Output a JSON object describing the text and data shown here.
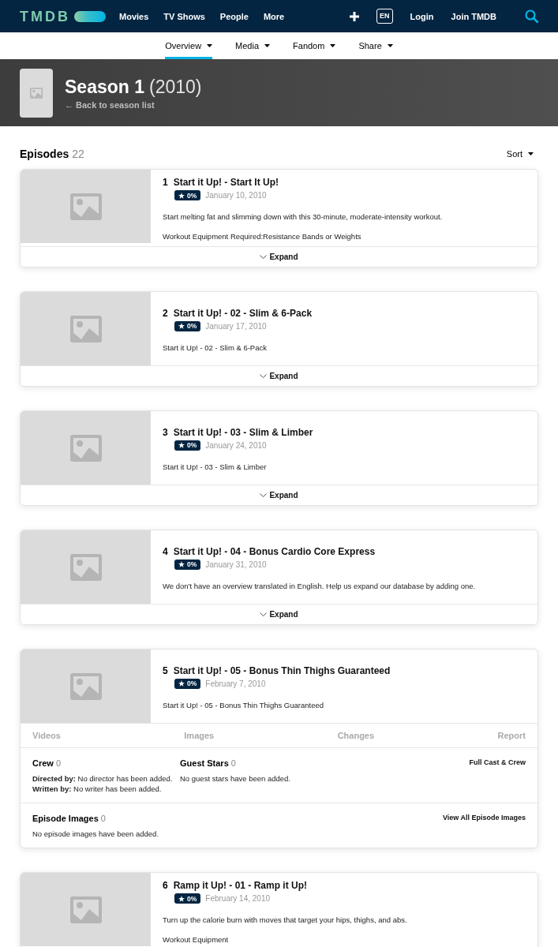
{
  "top_nav": {
    "logo": "TMDB",
    "links": [
      "Movies",
      "TV Shows",
      "People",
      "More"
    ],
    "language": "EN",
    "account_links": [
      "Login",
      "Join TMDB"
    ]
  },
  "sub_nav": {
    "tabs": [
      {
        "label": "Overview",
        "selected": true
      },
      {
        "label": "Media",
        "selected": false
      },
      {
        "label": "Fandom",
        "selected": false
      },
      {
        "label": "Share",
        "selected": false
      }
    ]
  },
  "season_header": {
    "title": "Season 1",
    "year": "(2010)",
    "back_link": "← Back to season list"
  },
  "episodes_section": {
    "heading": "Episodes",
    "count": "22",
    "sort_label": "Sort"
  },
  "episodes": [
    {
      "number": "1",
      "title": "Start it Up! - Start It Up!",
      "rating": "0%",
      "air_date": "January 10, 2010",
      "overview": [
        "Start melting fat and slimming down with this 30-minute, moderate-intensity workout.",
        "Workout Equipment Required:Resistance Bands or Weights"
      ],
      "expanded": false,
      "expand_label": "Expand"
    },
    {
      "number": "2",
      "title": "Start it Up! - 02 - Slim & 6-Pack",
      "rating": "0%",
      "air_date": "January 17, 2010",
      "overview": [
        "Start it Up! - 02 - Slim & 6-Pack"
      ],
      "expanded": false,
      "expand_label": "Expand"
    },
    {
      "number": "3",
      "title": "Start it Up! - 03 - Slim & Limber",
      "rating": "0%",
      "air_date": "January 24, 2010",
      "overview": [
        "Start it Up! - 03 - Slim & Limber"
      ],
      "expanded": false,
      "expand_label": "Expand"
    },
    {
      "number": "4",
      "title": "Start it Up! - 04 - Bonus Cardio Core Express",
      "rating": "0%",
      "air_date": "January 31, 2010",
      "overview": [
        "We don't have an overview translated in English. Help us expand our database by adding one."
      ],
      "expanded": false,
      "expand_label": "Expand"
    },
    {
      "number": "5",
      "title": "Start it Up! - 05 - Bonus Thin Thighs Guaranteed",
      "rating": "0%",
      "air_date": "February 7, 2010",
      "overview": [
        "Start it Up! - 05 - Bonus Thin Thighs Guaranteed"
      ],
      "expanded": true,
      "tabs": [
        "Videos",
        "Images",
        "Changes",
        "Report"
      ],
      "crew": {
        "heading": "Crew",
        "count": "0",
        "link": "Full Cast & Crew",
        "lines": [
          "**Directed by:** No director has been added.",
          "**Written by:** No writer has been added."
        ]
      },
      "guest_stars": {
        "heading": "Guest Stars",
        "count": "0",
        "text": "No guest stars have been added."
      },
      "episode_images": {
        "heading": "Episode Images",
        "count": "0",
        "link": "View All Episode Images",
        "text": "No episode images have been added."
      }
    },
    {
      "number": "6",
      "title": "Ramp it Up! - 01 - Ramp it Up!",
      "rating": "0%",
      "air_date": "February 14, 2010",
      "overview": [
        "Turn up the calorie burn with moves that target your hips, thighs, and abs.",
        "Workout Equipment"
      ],
      "expanded": false
    }
  ]
}
